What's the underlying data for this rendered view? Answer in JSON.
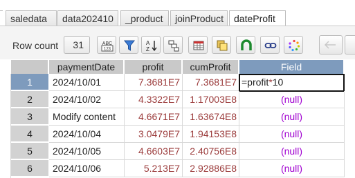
{
  "tabs": [
    {
      "label": "saledata"
    },
    {
      "label": "data202410"
    },
    {
      "label": "_product"
    },
    {
      "label": "joinProduct"
    },
    {
      "label": "dateProfit"
    }
  ],
  "active_tab": "dateProfit",
  "toolbar": {
    "row_count_label": "Row count",
    "row_count_value": "31",
    "buttons": [
      "abc-icon",
      "filter-icon",
      "sort-az-icon",
      "group-icon",
      "table-icon",
      "copy-icon",
      "magnet-icon",
      "link-icon",
      "spinner-icon",
      "back-arrow-icon",
      "forward-arrow-icon"
    ]
  },
  "grid": {
    "columns": [
      "paymentDate",
      "profit",
      "cumProfit",
      "Field"
    ],
    "rows": [
      {
        "num": "1",
        "paymentDate": "2024/10/01",
        "profit": "7.3681E7",
        "cumProfit": "7.3681E7",
        "field": "=profit*10"
      },
      {
        "num": "2",
        "paymentDate": "2024/10/02",
        "profit": "4.3322E7",
        "cumProfit": "1.17003E8",
        "field": "(null)"
      },
      {
        "num": "3",
        "paymentDate": "Modify content",
        "profit": "4.6671E7",
        "cumProfit": "1.63674E8",
        "field": "(null)"
      },
      {
        "num": "4",
        "paymentDate": "2024/10/04",
        "profit": "3.0479E7",
        "cumProfit": "1.94153E8",
        "field": "(null)"
      },
      {
        "num": "5",
        "paymentDate": "2024/10/05",
        "profit": "4.6603E7",
        "cumProfit": "2.40756E8",
        "field": "(null)"
      },
      {
        "num": "6",
        "paymentDate": "2024/10/06",
        "profit": "5.213E7",
        "cumProfit": "2.92886E8",
        "field": "(null)"
      }
    ],
    "editing_formula": {
      "prefix": "=profit",
      "op": "*",
      "suffix": "10"
    }
  },
  "colors": {
    "header_bg": "#c9c9c9",
    "selected_header": "#7e9bbd",
    "number_text": "#9b3b3b",
    "null_text": "#a000d0"
  }
}
